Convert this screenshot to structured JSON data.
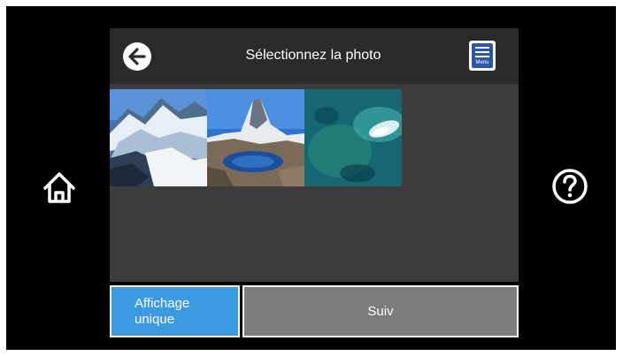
{
  "header": {
    "title": "Sélectionnez la photo",
    "back_icon": "arrow-left-icon",
    "menu_icon": "menu-icon",
    "menu_label": "Menu"
  },
  "side": {
    "home_icon": "home-icon",
    "help_icon": "question-mark-icon"
  },
  "photos": [
    {
      "subject": "snowy mountain ridge"
    },
    {
      "subject": "matterhorn lake reflection"
    },
    {
      "subject": "aerial sea reef"
    }
  ],
  "footer": {
    "single_view_line1": "Affichage",
    "single_view_line2": "unique",
    "next_label": "Suiv"
  },
  "colors": {
    "accent": "#3c9be0",
    "next_button": "#7c7c7c",
    "grid_bg": "#3c3c3c",
    "topbar_bg": "#2a2a2a",
    "menu_blue": "#2b57a8"
  }
}
